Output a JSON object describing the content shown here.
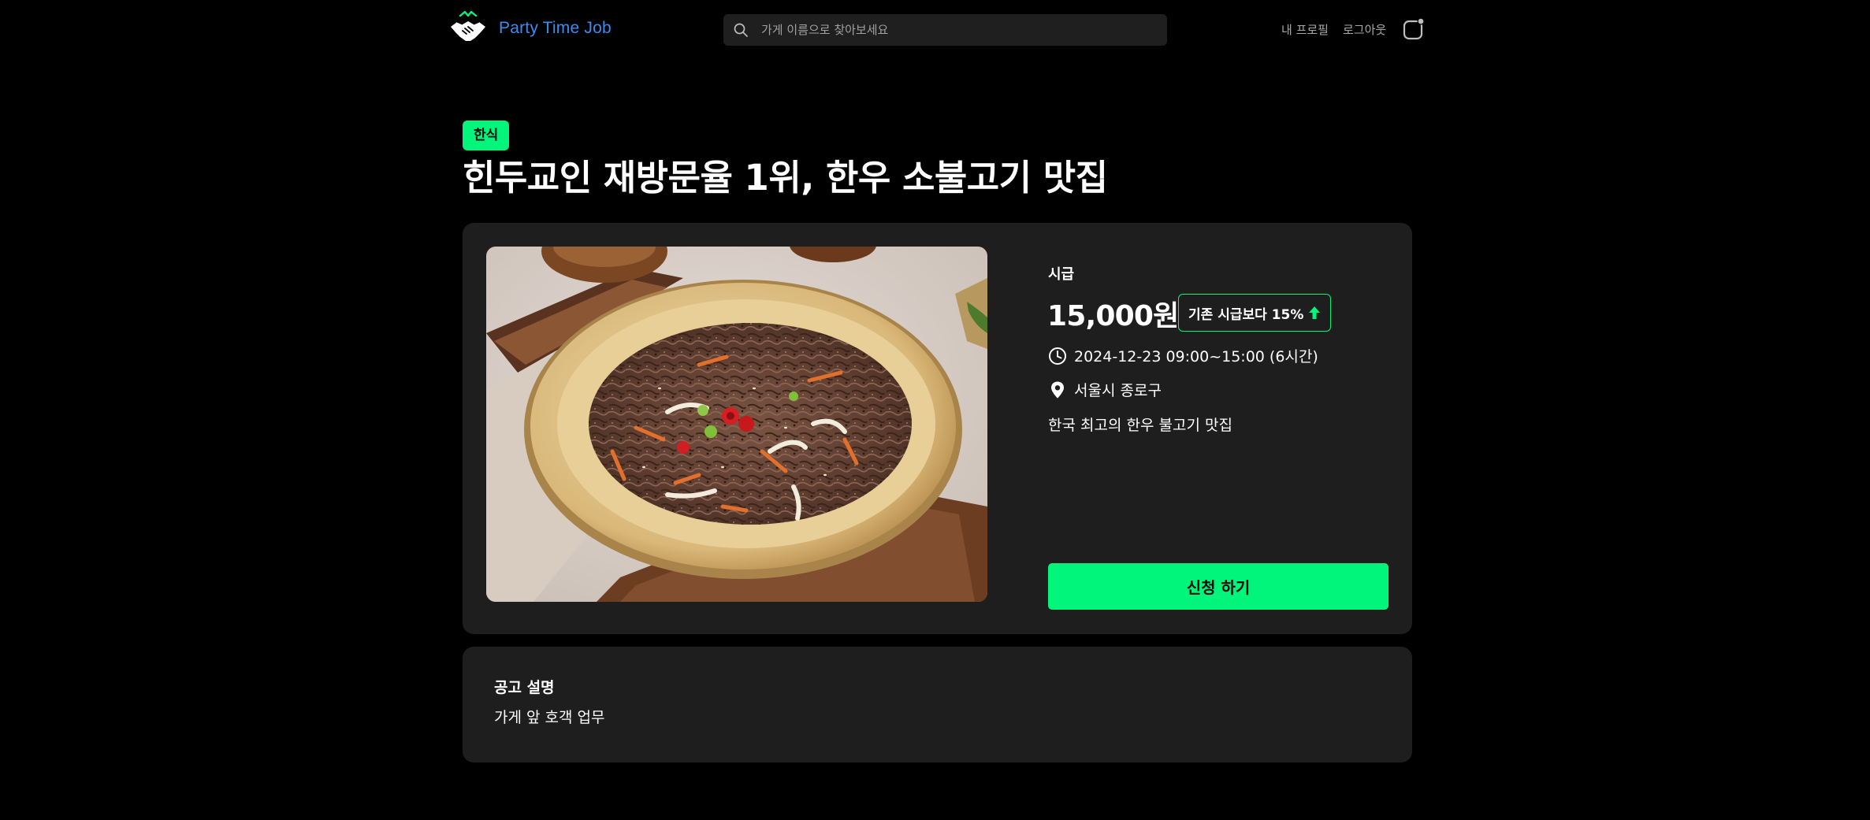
{
  "header": {
    "brand": "Party Time Job",
    "search_placeholder": "가게 이름으로 찾아보세요",
    "nav_profile": "내 프로필",
    "nav_logout": "로그아웃"
  },
  "post": {
    "category": "한식",
    "title": "힌두교인 재방문율 1위, 한우 소불고기 맛집",
    "wage_label": "시급",
    "wage_amount": "15,000원",
    "wage_raise": "기존 시급보다 15%",
    "schedule": "2024-12-23 09:00~15:00 (6시간)",
    "location": "서울시 종로구",
    "store_description": "한국 최고의 한우 불고기 맛집",
    "apply_label": "신청 하기"
  },
  "notice": {
    "title": "공고 설명",
    "body": "가게 앞 호객 업무"
  },
  "colors": {
    "accent": "#00f57a",
    "brand_text": "#3b8cf0",
    "card_bg": "#1e1e1e",
    "page_bg": "#000000"
  },
  "icons": [
    "handshake-logo-icon",
    "search-icon",
    "bell-icon",
    "clock-icon",
    "location-pin-icon",
    "arrow-up-icon"
  ]
}
